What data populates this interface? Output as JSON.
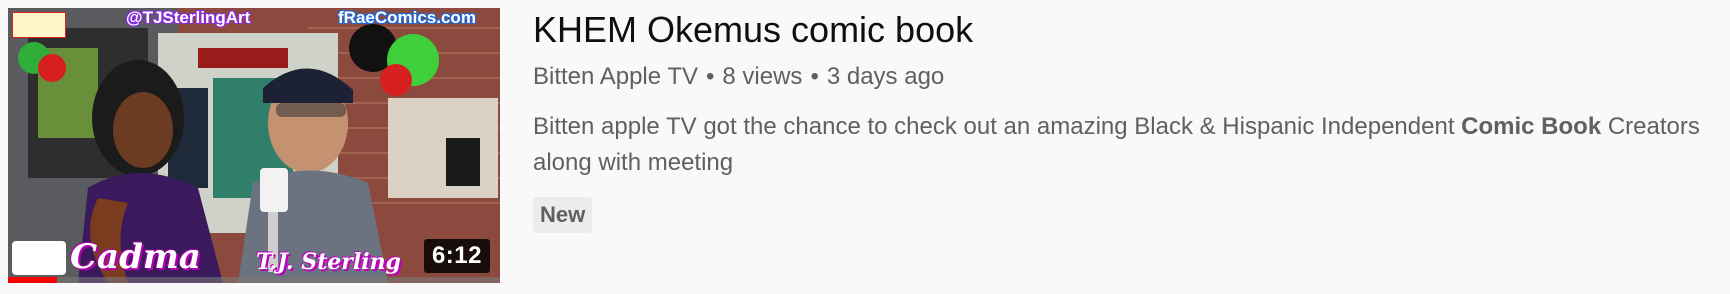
{
  "video": {
    "title": "KHEM Okemus comic book",
    "channel": "Bitten Apple TV",
    "views": "8 views",
    "uploaded": "3 days ago",
    "separator": "•",
    "description_before": "Bitten apple TV got the chance to check out an amazing Black & Hispanic Independent ",
    "description_highlight": "Comic Book",
    "description_after": " Creators along with meeting",
    "badge": "New",
    "duration": "6:12",
    "watch_progress": 0.1
  },
  "thumbnail": {
    "handle_left": "@TJSterlingArt",
    "handle_right": "fRaeComics.com",
    "caption_left": "Cadma",
    "caption_right": "T.J. Sterling"
  },
  "colors": {
    "progress": "#ff0000",
    "title": "#0f0f0f",
    "meta": "#606060",
    "badge_bg": "#ececec"
  }
}
